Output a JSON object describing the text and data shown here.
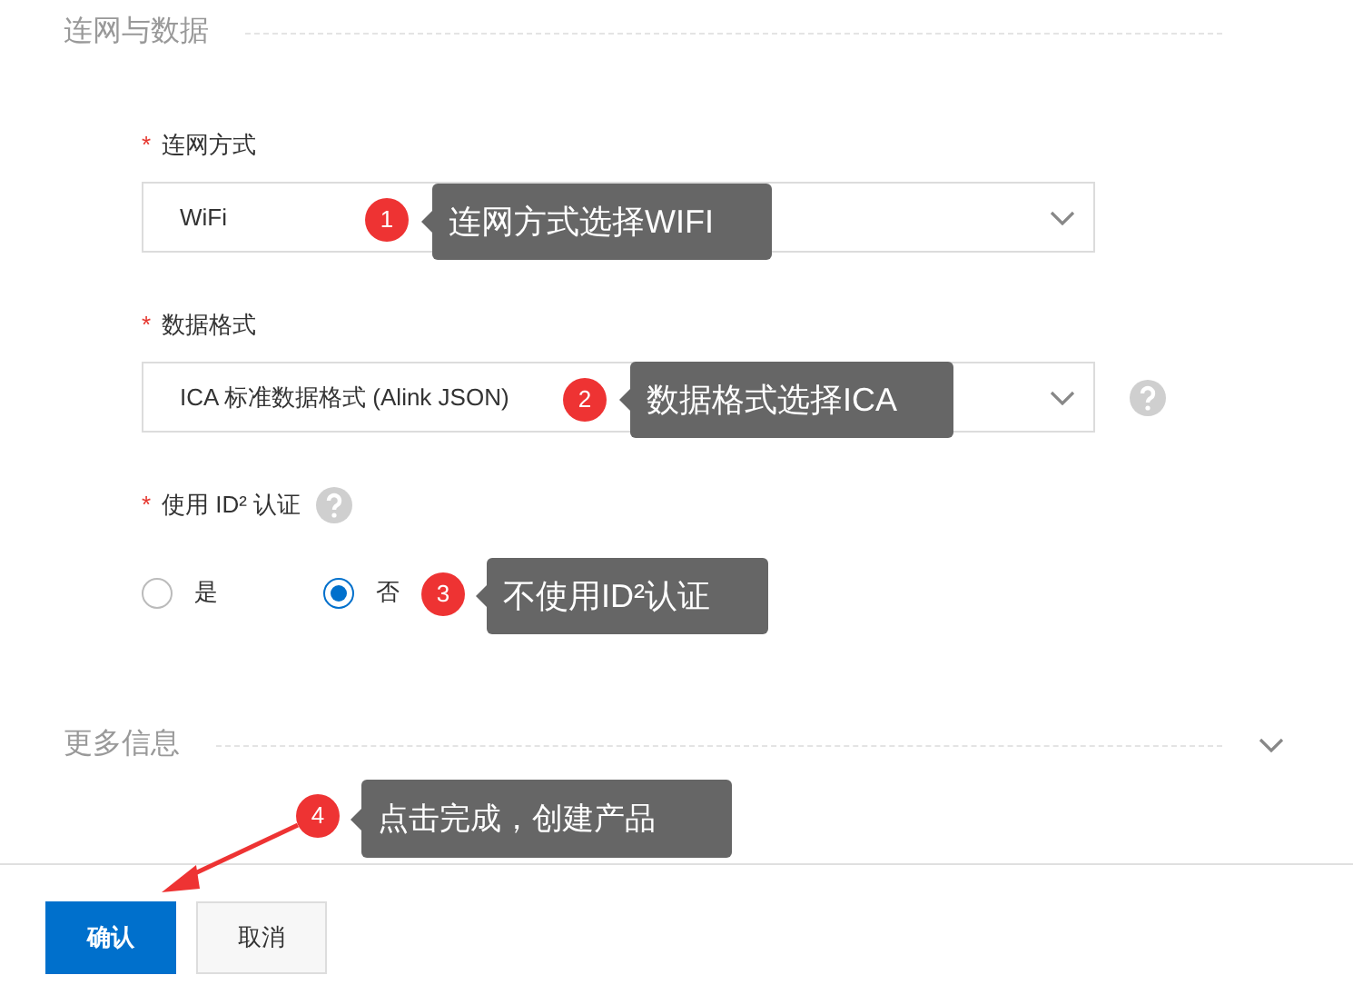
{
  "sections": [
    {
      "title": "连网与数据",
      "expanded": true,
      "fields": [
        {
          "kind": "select",
          "required_mark": "*",
          "label": "连网方式",
          "value": "WiFi",
          "help": false
        },
        {
          "kind": "select",
          "required_mark": "*",
          "label": "数据格式",
          "value": "ICA 标准数据格式 (Alink JSON)",
          "help": true
        },
        {
          "kind": "radio",
          "required_mark": "*",
          "label": "使用 ID² 认证",
          "help": true,
          "options": [
            {
              "label": "是",
              "selected": false
            },
            {
              "label": "否",
              "selected": true
            }
          ]
        }
      ]
    },
    {
      "title": "更多信息",
      "expanded": false
    }
  ],
  "annotations": [
    {
      "number": "1",
      "text": "连网方式选择WIFI"
    },
    {
      "number": "2",
      "text": "数据格式选择ICA"
    },
    {
      "number": "3",
      "text": "不使用ID²认证"
    },
    {
      "number": "4",
      "text": "点击完成，创建产品"
    }
  ],
  "buttons": [
    {
      "label": "确认",
      "kind": "primary"
    },
    {
      "label": "取消",
      "kind": "secondary"
    }
  ]
}
